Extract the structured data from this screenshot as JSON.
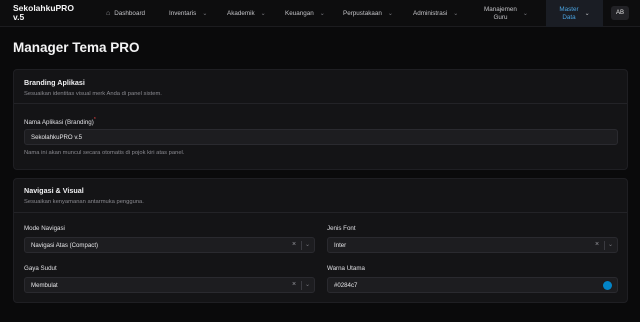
{
  "app": {
    "brand_line1": "SekolahkuPRO",
    "brand_line2": "v.5"
  },
  "nav": {
    "dashboard": "Dashboard",
    "inventaris": "Inventaris",
    "akademik": "Akademik",
    "keuangan": "Keuangan",
    "perpustakaan": "Perpustakaan",
    "administrasi": "Administrasi",
    "manajemen_line1": "Manajemen",
    "manajemen_line2": "Guru",
    "master_line1": "Master",
    "master_line2": "Data",
    "avatar": "AB"
  },
  "page": {
    "title": "Manager Tema PRO"
  },
  "branding": {
    "title": "Branding Aplikasi",
    "subtitle": "Sesuaikan identitas visual merk Anda di panel sistem.",
    "name_label": "Nama Aplikasi (Branding)",
    "name_required": "*",
    "name_value": "SekolahkuPRO v.5",
    "name_help": "Nama ini akan muncul secara otomatis di pojok kiri atas panel."
  },
  "navigasi": {
    "title": "Navigasi & Visual",
    "subtitle": "Sesuaikan kenyamanan antarmuka pengguna.",
    "mode_label": "Mode Navigasi",
    "mode_value": "Navigasi Atas (Compact)",
    "font_label": "Jenis Font",
    "font_value": "Inter",
    "sudut_label": "Gaya Sudut",
    "sudut_value": "Membulat",
    "warna_label": "Warna Utama",
    "warna_value": "#0284c7"
  },
  "icons": {
    "dashboard": "house-icon",
    "chevron": "chevron-down-icon",
    "clear": "close-icon"
  },
  "colors": {
    "accent": "#4aa3e0",
    "primary_swatch": "#0284c7",
    "required": "#ef4444"
  }
}
